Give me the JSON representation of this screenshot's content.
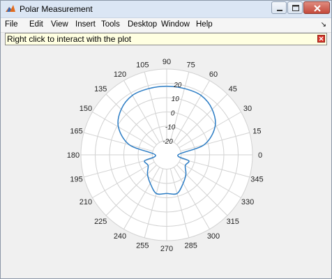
{
  "window": {
    "title": "Polar Measurement"
  },
  "menubar": {
    "items": [
      "File",
      "Edit",
      "View",
      "Insert",
      "Tools",
      "Desktop",
      "Window",
      "Help"
    ]
  },
  "infobar": {
    "text": "Right click to interact with the plot",
    "close_icon": "close-icon"
  },
  "colors": {
    "trace": "#2b7cc4",
    "grid": "#d2d2d2",
    "plot_bg": "#ffffff",
    "window_bg": "#f0f0f0"
  },
  "polar": {
    "angle_labels": [
      "0",
      "15",
      "30",
      "45",
      "60",
      "75",
      "90",
      "105",
      "120",
      "135",
      "150",
      "165",
      "180",
      "195",
      "210",
      "225",
      "240",
      "255",
      "270",
      "285",
      "300",
      "315",
      "330",
      "345"
    ],
    "magnitude_labels": [
      "20",
      "10",
      "0",
      "-10",
      "-20"
    ],
    "magnitude_range": [
      -30,
      30
    ],
    "angle_direction": "counterclockwise",
    "zero_angle": "right"
  },
  "chart_data": {
    "type": "line",
    "title": "",
    "projection": "polar",
    "x_unit": "degrees",
    "x": [
      0,
      15,
      30,
      45,
      60,
      75,
      90,
      105,
      120,
      135,
      150,
      165,
      180,
      195,
      210,
      225,
      240,
      255,
      270,
      285,
      300,
      315,
      330,
      345,
      360
    ],
    "series": [
      {
        "values": [
          -22,
          -3,
          9,
          15,
          18,
          18,
          18,
          18,
          18,
          15,
          9,
          -3,
          -22,
          -14,
          -15,
          -11,
          -7,
          -2,
          -3,
          -2,
          -7,
          -11,
          -15,
          -14,
          -22
        ]
      }
    ],
    "rlim": [
      -30,
      30
    ],
    "grid": true
  }
}
